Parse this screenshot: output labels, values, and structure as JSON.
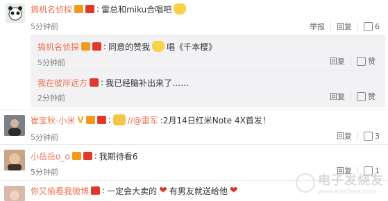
{
  "comments": [
    {
      "user": "搞机名侦探",
      "text": "雷总和miku合唱吧",
      "time": "5分钟前",
      "report_label": "举报",
      "reply_label": "回复",
      "like_count": "6"
    },
    {
      "user": "搞机名侦探",
      "text_pre": "同意的赞我",
      "text_post": "唱《千本樱》",
      "time": "5分钟前",
      "reply_label": "回复",
      "like_label": "赞"
    },
    {
      "user": "我在彼岸远方",
      "text": "我已经脑补出来了……",
      "time": "2分钟前",
      "reply_label": "回复",
      "like_label": "赞"
    },
    {
      "user": "崔宝秋-小米",
      "mention": "//@雷军",
      "text": ":2月14日红米Note 4X首发！",
      "time": "5分钟前",
      "reply_label": "回复",
      "like_count": "3"
    },
    {
      "user": "小岳岳o_o",
      "text": "我期待看6",
      "time": "5分钟前",
      "reply_label": "回复",
      "like_count": "1"
    },
    {
      "user": "你又偷看我微博",
      "text_pre": "一定会大卖的",
      "text_post": "有男友就送给他"
    }
  ],
  "watermark": {
    "text": "电子发烧友",
    "url": "www.elecfans.com"
  },
  "colors": {
    "username": "#eb7350",
    "reply_bg": "#f2f2f5"
  }
}
